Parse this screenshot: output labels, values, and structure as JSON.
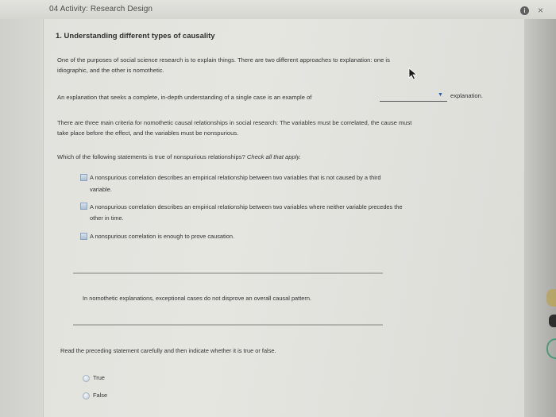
{
  "window": {
    "title": "04 Activity: Research Design",
    "info_glyph": "i",
    "close_glyph": "×"
  },
  "question": {
    "heading": "1. Understanding different types of causality",
    "intro_line1": "One of the purposes of social science research is to explain things. There are two different approaches to explanation: one is",
    "intro_line2": "idiographic, and the other is nomothetic.",
    "blank_prompt": "An explanation that seeks a complete, in-depth understanding of a single case is an example of",
    "blank_value": "",
    "blank_suffix": "explanation.",
    "criteria_line1": "There are three main criteria for nomothetic causal relationships in social research: The variables must be correlated, the cause must",
    "criteria_line2": "take place before the effect, and the variables must be nonspurious.",
    "check_prompt": "Which of the following statements is true of nonspurious relationships?",
    "check_hint": "Check all that apply.",
    "options": [
      {
        "line1": "A nonspurious correlation describes an empirical relationship between two variables that is not caused by a third",
        "line2": "variable.",
        "checked": false
      },
      {
        "line1": "A nonspurious correlation describes an empirical relationship between two variables where neither variable precedes the",
        "line2": "other in time.",
        "checked": false
      },
      {
        "line1": "A nonspurious correlation is enough to prove causation.",
        "checked": false
      }
    ],
    "statement": "In nomothetic explanations, exceptional cases do not disprove an overall causal pattern.",
    "tf_instruction": "Read the preceding statement carefully and then indicate whether it is true or false.",
    "tf_options": [
      {
        "label": "True",
        "selected": false
      },
      {
        "label": "False",
        "selected": false
      }
    ]
  },
  "icons": {
    "dropdown": "triangle-down",
    "cursor": "mouse-pointer",
    "info": "info-circle",
    "close": "x-mark"
  },
  "colors": {
    "dropdown_arrow": "#1f5fae",
    "checkbox_fill": "#aebfd0",
    "page_background": "#e4e4df"
  }
}
